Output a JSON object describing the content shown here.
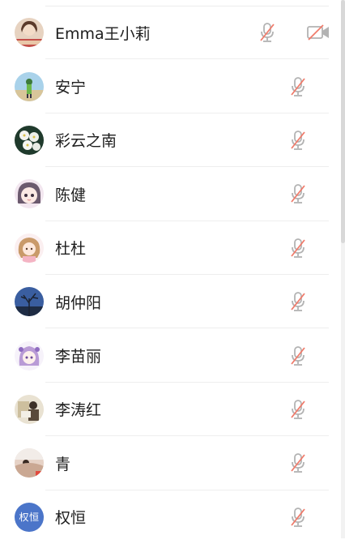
{
  "participants": [
    {
      "name": "Emma王小莉",
      "avatar": "photo-avatar",
      "mic": "mic-off-icon",
      "camera": "camera-off-icon"
    },
    {
      "name": "安宁",
      "avatar": "photo-avatar",
      "mic": "mic-off-icon"
    },
    {
      "name": "彩云之南",
      "avatar": "photo-avatar",
      "mic": "mic-off-icon"
    },
    {
      "name": "陈健",
      "avatar": "photo-avatar",
      "mic": "mic-off-icon"
    },
    {
      "name": "杜杜",
      "avatar": "photo-avatar",
      "mic": "mic-off-icon"
    },
    {
      "name": "胡仲阳",
      "avatar": "photo-avatar",
      "mic": "mic-off-icon"
    },
    {
      "name": "李苗丽",
      "avatar": "photo-avatar",
      "mic": "mic-off-icon"
    },
    {
      "name": "李涛红",
      "avatar": "photo-avatar",
      "mic": "mic-off-icon"
    },
    {
      "name": "青",
      "avatar": "photo-avatar",
      "mic": "mic-off-icon"
    },
    {
      "name": "权恒",
      "avatar": "initials-avatar",
      "avatar_text": "权恒",
      "mic": "mic-off-icon"
    }
  ],
  "colors": {
    "mute_slash": "#f07b6b",
    "icon_gray": "#b3b3b3",
    "initials_bg": "#4b75c9"
  }
}
